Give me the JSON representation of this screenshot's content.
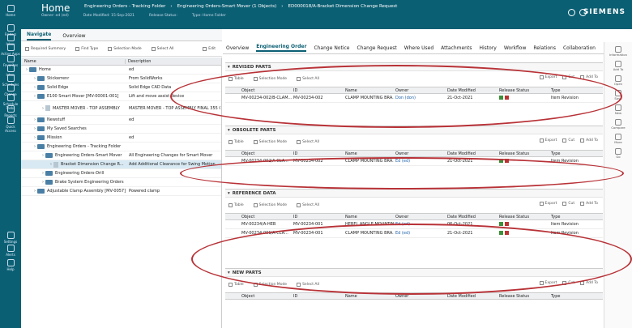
{
  "header": {
    "home": "Home",
    "crumbs": [
      "Engineering Orders - Tracking Folder",
      "Engineering Orders-Smart Mover (1 Objects)",
      "ED000018/A-Bracket Dimension Change Request"
    ],
    "meta": [
      "Owner: ed (ed)",
      "Date Modified: 15-Sep-2021",
      "Release Status:",
      "Type: Home Folder"
    ],
    "logo": "SIEMENS"
  },
  "rail": [
    "Home",
    "Folders",
    "Inbox",
    "Active Apps",
    "Favorites",
    "Inbox",
    "Schedules",
    "Change",
    "Schedule Tasks",
    "Reports",
    "Quick Access",
    "Settings",
    "Alerts",
    "Help"
  ],
  "navtabs": [
    "Navigate",
    "Overview"
  ],
  "ltool": [
    "Required Summary",
    "Find Type",
    "Selection Mode",
    "Select All",
    "Edit"
  ],
  "tree": {
    "headers": [
      "Name",
      "Description"
    ],
    "rows": [
      {
        "name": "Home",
        "desc": "ed",
        "indent": 0
      },
      {
        "name": "Stickerrenr",
        "desc": "From SolidWorks",
        "indent": 1
      },
      {
        "name": "Solid Edge",
        "desc": "Solid Edge CAD Data",
        "indent": 1
      },
      {
        "name": "E100 Smart Mover [MV-00001-001]",
        "desc": "Lift and move assist device",
        "indent": 1
      },
      {
        "name": "MASTER MOVER - TOP ASSEMBLY",
        "desc": "MASTER MOVER - TOP ASSEMBLY FINAL 355 GN",
        "indent": 2
      },
      {
        "name": "Newstuff",
        "desc": "ed",
        "indent": 1
      },
      {
        "name": "My Saved Searches",
        "desc": "",
        "indent": 1
      },
      {
        "name": "Mission",
        "desc": "ed",
        "indent": 1
      },
      {
        "name": "Engineering Orders - Tracking Folder",
        "desc": "",
        "indent": 1
      },
      {
        "name": "Engineering Orders-Smart Mover",
        "desc": "All Engineering Changes for Smart Mover",
        "indent": 2
      },
      {
        "name": "Bracket Dimension Change R...",
        "desc": "Add Additional Clearance for Swing Motion",
        "indent": 3
      },
      {
        "name": "Engineering Orders-Drill",
        "desc": "",
        "indent": 2
      },
      {
        "name": "Brake System Engineering Orders",
        "desc": "",
        "indent": 2
      },
      {
        "name": "Adjustable Clamp Assembly [MV-0057]",
        "desc": "Powered clamp",
        "indent": 1
      }
    ]
  },
  "tabs": [
    "Overview",
    "Engineering Order",
    "Change Notice",
    "Change Request",
    "Where Used",
    "Attachments",
    "History",
    "Workflow",
    "Relations",
    "Collaboration"
  ],
  "rtool": [
    "Information",
    "Add To",
    "Open",
    "Save",
    "New",
    "Compare",
    "More",
    "Go"
  ],
  "sections": [
    {
      "title": "REVISED PARTS",
      "row": [
        "MV-00234-002/B-CLAM...",
        "MV-00234-002",
        "CLAMP MOUNTING BRA...",
        "Don (don)",
        "21-Oct-2021",
        "Item Revision"
      ]
    },
    {
      "title": "OBSOLETE PARTS",
      "row": [
        "MV-00234-002/A-CLA...",
        "MV-00234-002",
        "CLAMP MOUNTING BRA...",
        "Ed (ed)",
        "21-Oct-2021",
        "Item Revision"
      ]
    },
    {
      "title": "REFERENCE DATA",
      "row": [
        "MV-00234/A-HEB",
        "MV-00234-001",
        "HEBEL ANGLE MOUNTING BRA...",
        "Ed (ed)",
        "06-Oct-2021",
        "Item Revision"
      ],
      "row2": [
        "MV-00234-001/A-CLA...",
        "MV-00234-001",
        "CLAMP MOUNTING BRA...",
        "Ed (ed)",
        "21-Oct-2021",
        "Item Revision"
      ]
    },
    {
      "title": "NEW PARTS"
    }
  ],
  "grid_headers": [
    "Object",
    "ID",
    "Name",
    "Owner",
    "Date Modified",
    "Release Status",
    "Type"
  ],
  "sec_tools": [
    "Table",
    "Selection Mode",
    "Select All"
  ],
  "sec_tools_right": [
    "Export",
    "Cut",
    "Add To"
  ]
}
